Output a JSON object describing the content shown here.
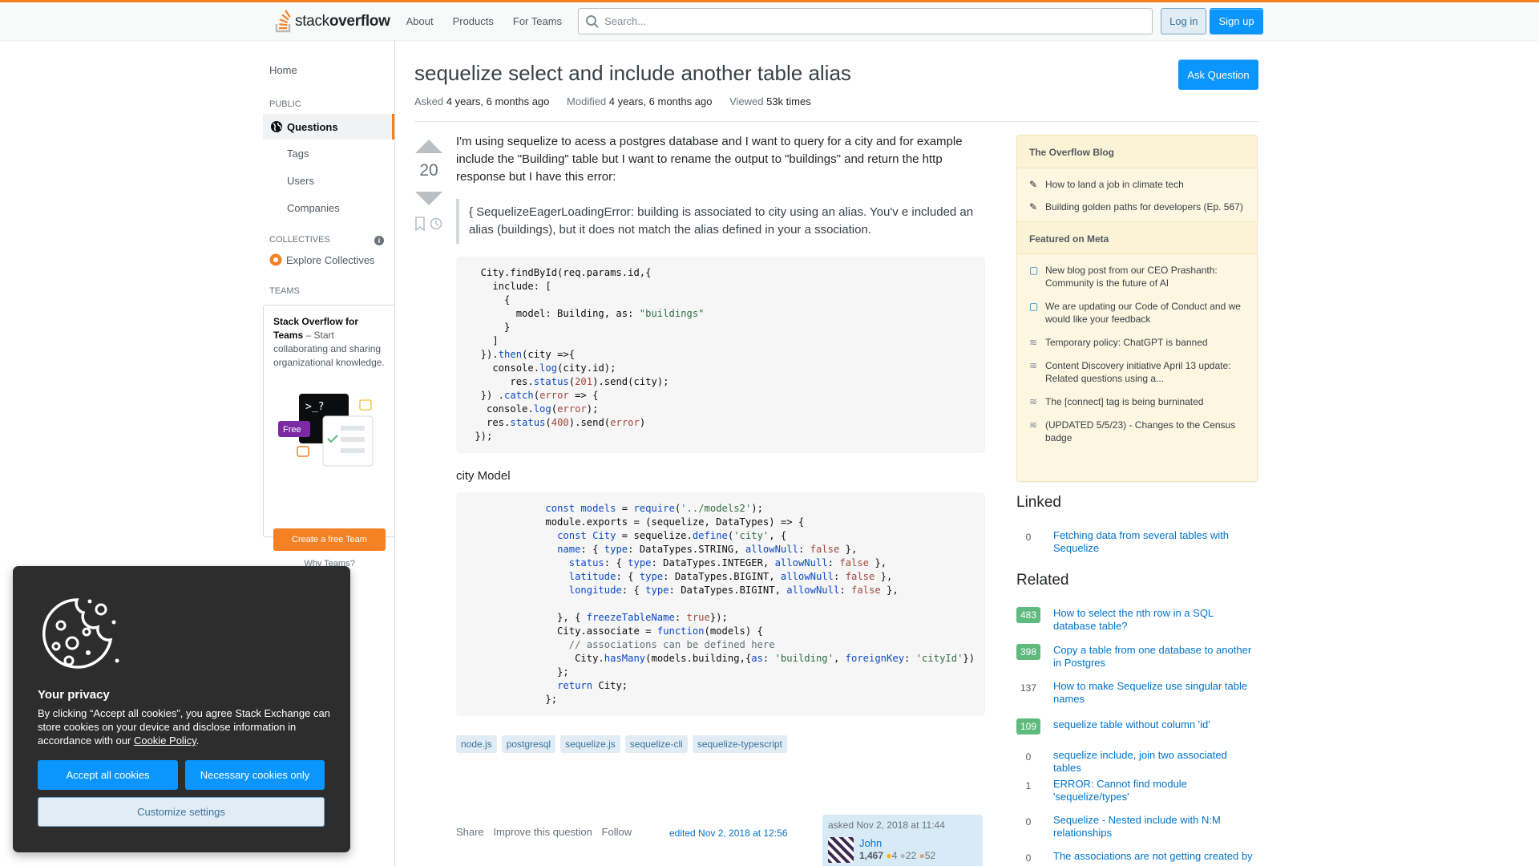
{
  "header": {
    "logo_text_light": "stack",
    "logo_text_bold": "overflow",
    "nav": [
      "About",
      "Products",
      "For Teams"
    ],
    "search_placeholder": "Search...",
    "login": "Log in",
    "signup": "Sign up",
    "accent": "#f48225"
  },
  "sidebar": {
    "home": "Home",
    "public_label": "PUBLIC",
    "questions": "Questions",
    "tags": "Tags",
    "users": "Users",
    "companies": "Companies",
    "collectives_label": "COLLECTIVES",
    "explore_collectives": "Explore Collectives",
    "teams_label": "TEAMS",
    "teams_title": "Stack Overflow for Teams",
    "teams_desc": " – Start collaborating and sharing organizational knowledge.",
    "free_badge": "Free",
    "terminal_prompt": ">_?",
    "create_team": "Create a free Team",
    "why_teams": "Why Teams?"
  },
  "question": {
    "title": "sequelize select and include another table alias",
    "ask_button": "Ask Question",
    "asked_label": "Asked",
    "asked_value": "4 years, 6 months ago",
    "modified_label": "Modified",
    "modified_value": "4 years, 6 months ago",
    "viewed_label": "Viewed",
    "viewed_value": "53k times",
    "votes": "20",
    "body_p1": "I'm using sequelize to acess a postgres database and I want to query for a city and for example include the \"Building\" table but I want to rename the output to \"buildings\" and return the http response but I have this error:",
    "quote": "{ SequelizeEagerLoadingError: building is associated to city using an alias. You'v e included an alias (buildings), but it does not match the alias defined in your a ssociation.",
    "city_model_label": "city Model",
    "tags": [
      "node.js",
      "postgresql",
      "sequelize.js",
      "sequelize-cli",
      "sequelize-typescript"
    ],
    "share": "Share",
    "improve": "Improve this question",
    "follow": "Follow",
    "edited": "edited Nov 2, 2018 at 12:56",
    "asked_card": "asked Nov 2, 2018 at 11:44",
    "user_name": "John",
    "user_rep": "1,467",
    "user_gold": "4",
    "user_silver": "22",
    "user_bronze": "52"
  },
  "blog": {
    "heading": "The Overflow Blog",
    "items": [
      "How to land a job in climate tech",
      "Building golden paths for developers (Ep. 567)"
    ],
    "meta_heading": "Featured on Meta",
    "meta_items": [
      "New blog post from our CEO Prashanth: Community is the future of AI",
      "We are updating our Code of Conduct and we would like your feedback",
      "Temporary policy: ChatGPT is banned",
      "Content Discovery initiative April 13 update: Related questions using a...",
      "The [connect] tag is being burninated",
      "(UPDATED 5/5/23) - Changes to the Census badge"
    ]
  },
  "linked": {
    "heading": "Linked",
    "items": [
      {
        "count": "0",
        "title": "Fetching data from several tables with Sequelize"
      }
    ]
  },
  "related": {
    "heading": "Related",
    "items": [
      {
        "count": "483",
        "title": "How to select the nth row in a SQL database table?"
      },
      {
        "count": "398",
        "title": "Copy a table from one database to another in Postgres"
      },
      {
        "count": "137",
        "title": "How to make Sequelize use singular table names"
      },
      {
        "count": "109",
        "title": "sequelize table without column 'id'"
      },
      {
        "count": "0",
        "title": "sequelize include, join two associated tables"
      },
      {
        "count": "1",
        "title": "ERROR: Cannot find module 'sequelize/types'"
      },
      {
        "count": "0",
        "title": "Sequelize - Nested include with N:M relationships"
      },
      {
        "count": "0",
        "title": "The associations are not getting created by"
      }
    ]
  },
  "cookie": {
    "title": "Your privacy",
    "text": "By clicking “Accept all cookies”, you agree Stack Exchange can store cookies on your device and disclose information in accordance with our ",
    "policy_link": "Cookie Policy",
    "accept": "Accept all cookies",
    "necessary": "Necessary cookies only",
    "customize": "Customize settings"
  }
}
